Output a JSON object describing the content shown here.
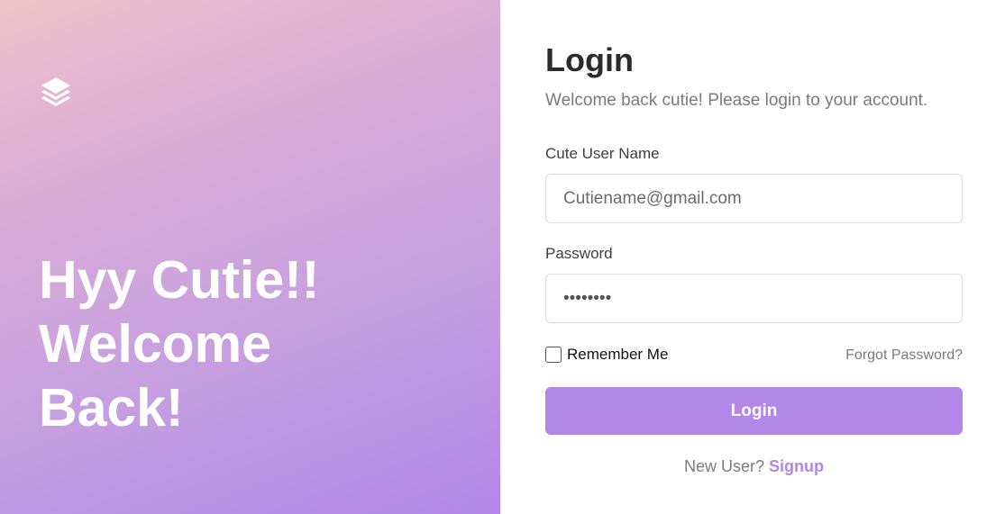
{
  "hero": {
    "lines": [
      "Hyy Cutie!!",
      "Welcome",
      "Back!"
    ],
    "logo_icon": "layers-icon"
  },
  "form": {
    "title": "Login",
    "subtitle": "Welcome back cutie! Please login to your account.",
    "username_label": "Cute User Name",
    "username_placeholder": "Cutiename@gmail.com",
    "password_label": "Password",
    "password_value": "password",
    "remember_label": "Remember Me",
    "remember_checked": false,
    "forgot_label": "Forgot Password?",
    "login_button": "Login",
    "new_user_text": "New User?",
    "signup_label": "Signup"
  },
  "colors": {
    "accent": "#b386ea",
    "gradient_start": "#efc3c9",
    "gradient_end": "#b386ea"
  }
}
